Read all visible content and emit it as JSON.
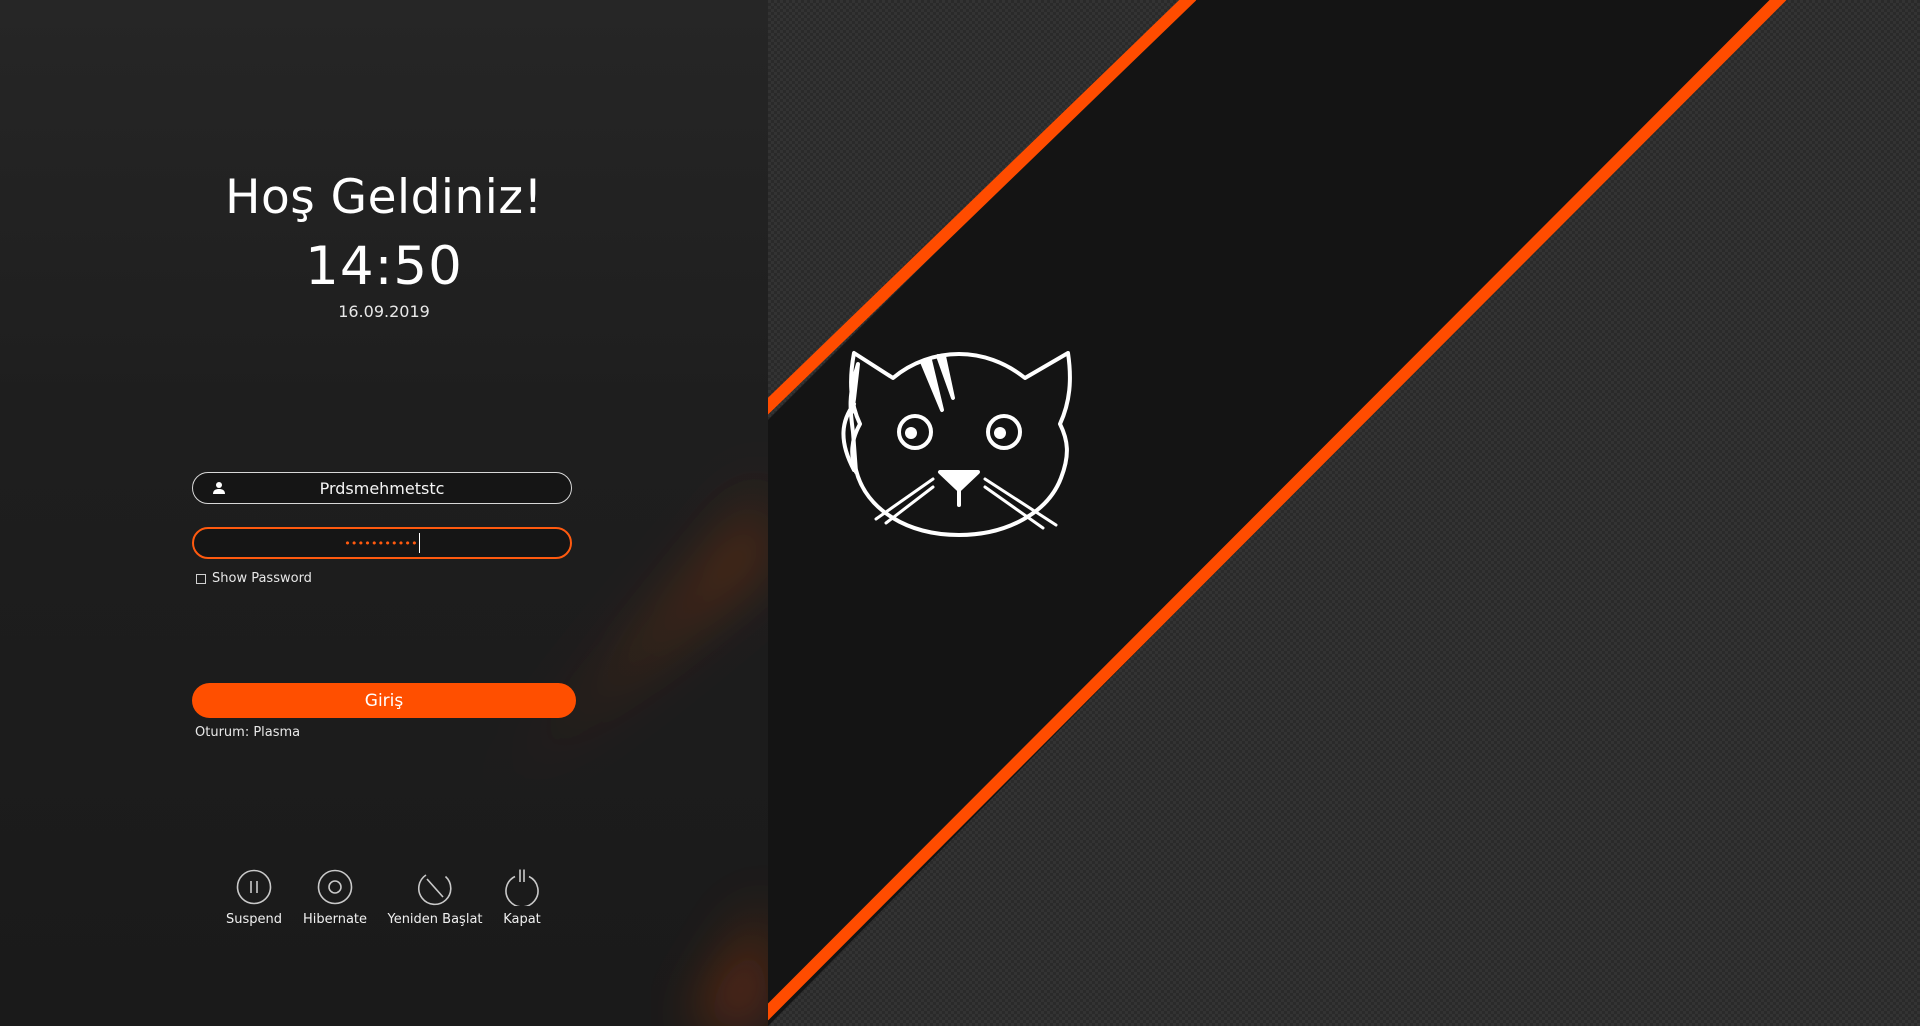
{
  "greeting": "Hoş Geldiniz!",
  "clock": {
    "time": "14:50",
    "date": "16.09.2019"
  },
  "login_form": {
    "username": "Prdsmehmetstc",
    "password_mask": "•••••••••••",
    "show_password_label": "Show Password",
    "show_password_checked": false,
    "submit_label": "Giriş",
    "session_label": "Oturum: Plasma"
  },
  "power_actions": [
    {
      "label": "Suspend",
      "icon": "pause-circle-icon"
    },
    {
      "label": "Hibernate",
      "icon": "hibernate-circle-icon"
    },
    {
      "label": "Yeniden Başlat",
      "icon": "restart-icon"
    },
    {
      "label": "Kapat",
      "icon": "power-icon"
    }
  ],
  "colors": {
    "accent": "#ff5a0f",
    "panel_background": "#222222",
    "wallpaper_background": "#1a1a1a",
    "text": "#ffffff"
  },
  "wallpaper": {
    "logo": "cat-face-logo"
  }
}
